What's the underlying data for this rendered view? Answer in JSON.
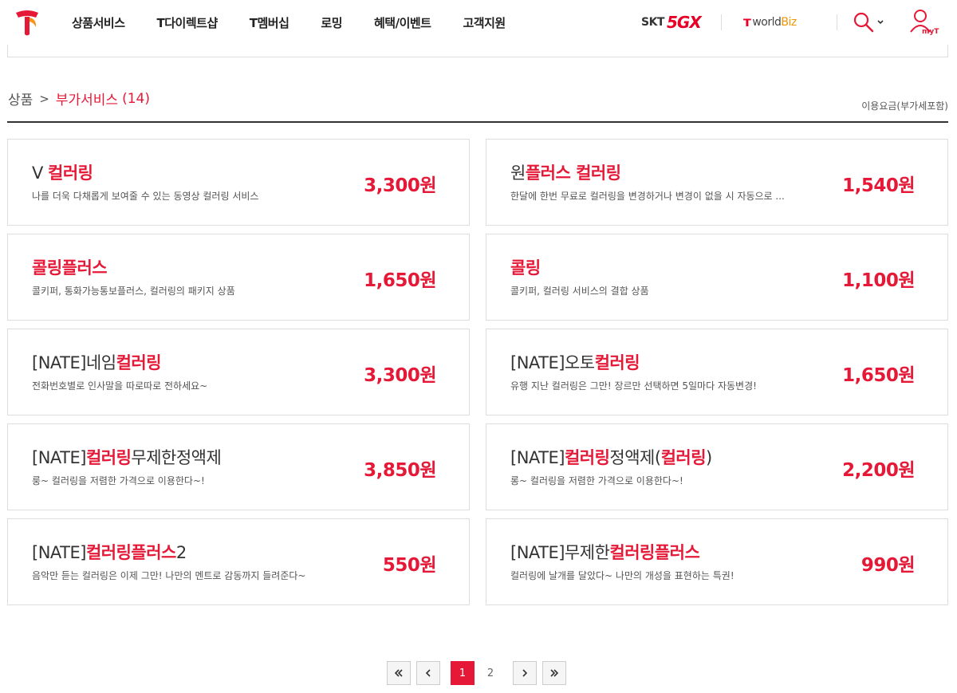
{
  "header": {
    "nav": [
      "상품서비스",
      "T다이렉트샵",
      "T멤버십",
      "로밍",
      "혜택/이벤트",
      "고객지원"
    ],
    "skt_label": "SKT",
    "fivegx_label": "5GX",
    "worldbiz": {
      "world": "world",
      "biz": "Biz"
    },
    "myt_label": "myT"
  },
  "breadcrumb": {
    "root": "상품",
    "separator": ">",
    "current": "부가서비스",
    "count": "(14)"
  },
  "price_note": "이용요금(부가세포함)",
  "products": [
    {
      "name_parts": [
        {
          "t": "V ",
          "hl": false
        },
        {
          "t": "컬러링",
          "hl": true
        }
      ],
      "desc": "나를 더욱 다채롭게 보여줄 수 있는 동영상 컬러링 서비스",
      "price": "3,300원"
    },
    {
      "name_parts": [
        {
          "t": "원",
          "hl": false
        },
        {
          "t": "플러스 컬러링",
          "hl": true
        }
      ],
      "desc": "한달에 한번 무료로 컬러링을 변경하거나 변경이 없을 시 자동으로 ...",
      "price": "1,540원"
    },
    {
      "name_parts": [
        {
          "t": "콜링플러스",
          "hl": true
        }
      ],
      "desc": "콜키퍼, 통화가능통보플러스, 컬러링의 패키지 상품",
      "price": "1,650원"
    },
    {
      "name_parts": [
        {
          "t": "콜링",
          "hl": true
        }
      ],
      "desc": "콜키퍼, 컬러링 서비스의 결합 상품",
      "price": "1,100원"
    },
    {
      "name_parts": [
        {
          "t": "[NATE]네임",
          "hl": false
        },
        {
          "t": "컬러링",
          "hl": true
        }
      ],
      "desc": "전화번호별로 인사말을 따로따로 전하세요~",
      "price": "3,300원"
    },
    {
      "name_parts": [
        {
          "t": "[NATE]오토",
          "hl": false
        },
        {
          "t": "컬러링",
          "hl": true
        }
      ],
      "desc": "유행 지난 컬러링은 그만! 장르만 선택하면 5일마다 자동변경!",
      "price": "1,650원"
    },
    {
      "name_parts": [
        {
          "t": "[NATE]",
          "hl": false
        },
        {
          "t": "컬러링",
          "hl": true
        },
        {
          "t": "무제한정액제",
          "hl": false
        }
      ],
      "desc": "룽~ 컬러링을 저렴한 가격으로 이용한다~!",
      "price": "3,850원"
    },
    {
      "name_parts": [
        {
          "t": "[NATE]",
          "hl": false
        },
        {
          "t": "컬러링",
          "hl": true
        },
        {
          "t": "정액제(",
          "hl": false
        },
        {
          "t": "컬러링",
          "hl": true
        },
        {
          "t": ")",
          "hl": false
        }
      ],
      "desc": "롱~ 컬러링을 저렴한 가격으로 이용한다~!",
      "price": "2,200원"
    },
    {
      "name_parts": [
        {
          "t": "[NATE]",
          "hl": false
        },
        {
          "t": "컬러링플러스",
          "hl": true
        },
        {
          "t": "2",
          "hl": false
        }
      ],
      "desc": "음악만 듣는 컬러링은 이제 그만! 나만의 멘트로 감동까지 들려준다~",
      "price": "550원"
    },
    {
      "name_parts": [
        {
          "t": "[NATE]무제한",
          "hl": false
        },
        {
          "t": "컬러링플러스",
          "hl": true
        }
      ],
      "desc": "컬러링에 날개를 달았다~ 나만의 개성을 표현하는 특권!",
      "price": "990원"
    }
  ],
  "pagination": {
    "pages": [
      "1",
      "2"
    ],
    "active": "1"
  },
  "colors": {
    "accent": "#e51937",
    "text": "#333333",
    "border": "#dddddd"
  },
  "icons": [
    "t-logo-icon",
    "search-icon",
    "chevron-down-icon",
    "user-icon",
    "double-chevron-left-icon",
    "chevron-left-icon",
    "chevron-right-icon",
    "double-chevron-right-icon"
  ]
}
